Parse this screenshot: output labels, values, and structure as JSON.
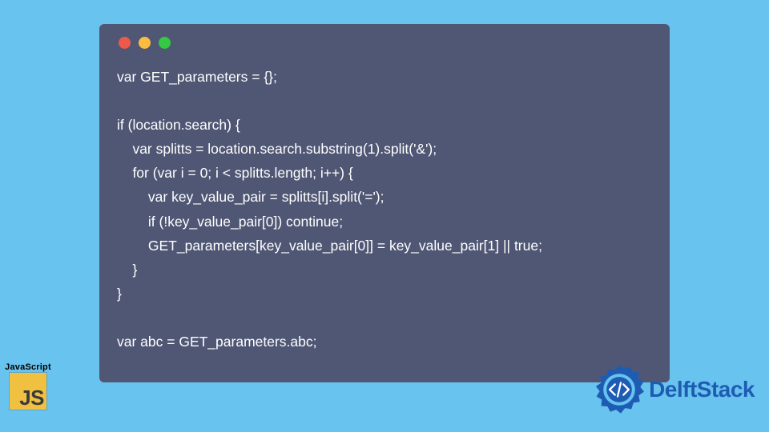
{
  "code": {
    "lines": [
      "var GET_parameters = {};",
      "",
      "if (location.search) {",
      "    var splitts = location.search.substring(1).split('&');",
      "    for (var i = 0; i < splitts.length; i++) {",
      "        var key_value_pair = splitts[i].split('=');",
      "        if (!key_value_pair[0]) continue;",
      "        GET_parameters[key_value_pair[0]] = key_value_pair[1] || true;",
      "    }",
      "}",
      "",
      "var abc = GET_parameters.abc;"
    ]
  },
  "js_badge": {
    "label": "JavaScript",
    "abbr": "JS"
  },
  "brand": {
    "name": "DelftStack"
  },
  "window": {
    "traffic": [
      "red",
      "yellow",
      "green"
    ]
  }
}
